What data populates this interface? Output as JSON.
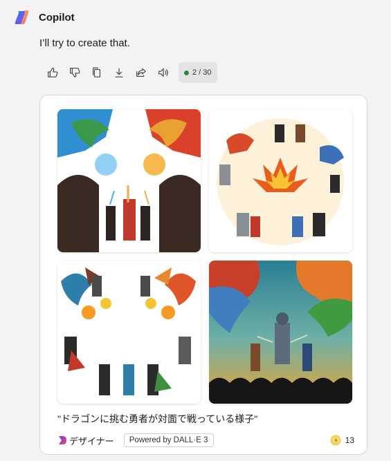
{
  "app": {
    "name": "Copilot",
    "logo_icon": "copilot-logo-icon"
  },
  "message": {
    "text": "I’ll try to create that."
  },
  "actions": {
    "icons": [
      "thumbs-up-icon",
      "thumbs-down-icon",
      "copy-icon",
      "download-icon",
      "share-icon",
      "speaker-icon"
    ],
    "counter": "2 / 30",
    "counter_color": "#2b8a3e"
  },
  "card": {
    "images": [
      {
        "name": "generated-image-1",
        "palette": [
          "#ffffff",
          "#d9412b",
          "#2f8fd1",
          "#2c2420"
        ]
      },
      {
        "name": "generated-image-2",
        "palette": [
          "#fdf1da",
          "#e85d1b",
          "#3b6fb6",
          "#2b2b2b"
        ]
      },
      {
        "name": "generated-image-3",
        "palette": [
          "#ffffff",
          "#e0542a",
          "#2d7ea8",
          "#2b2b2b"
        ]
      },
      {
        "name": "generated-image-4",
        "palette": [
          "#2a7f95",
          "#c8402a",
          "#e9a532",
          "#161616"
        ]
      }
    ],
    "caption": "\"ドラゴンに挑む勇者が対面で戦っている様子\"",
    "designer_label": "デザイナー",
    "powered_by": "Powered by DALL·E 3",
    "boost_count": "13"
  }
}
